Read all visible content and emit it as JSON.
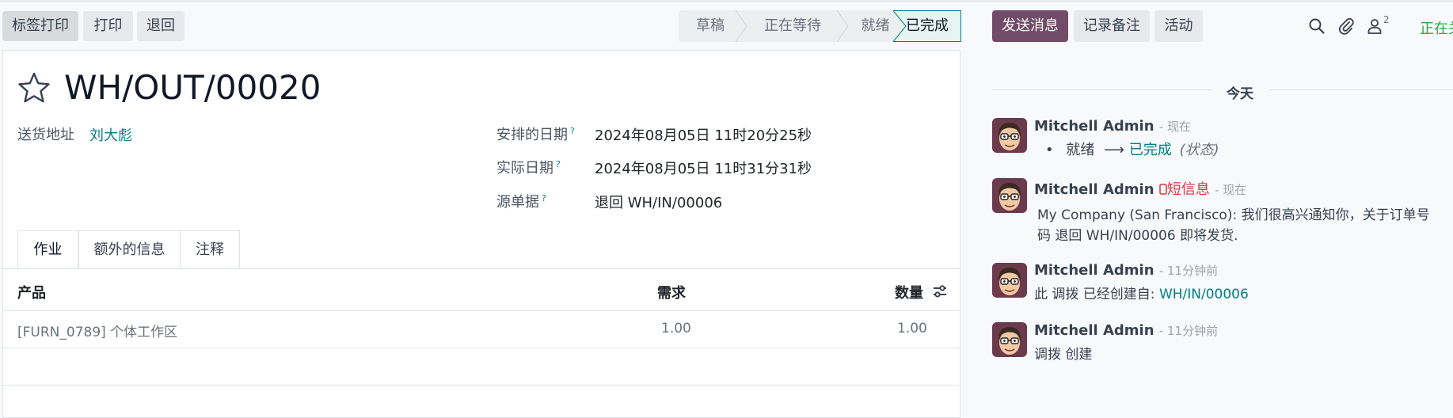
{
  "toolbar": {
    "label_print": "标签打印",
    "print": "打印",
    "return": "退回"
  },
  "statusbar": {
    "stages": [
      "草稿",
      "正在等待",
      "就绪",
      "已完成"
    ],
    "active_stage": "已完成"
  },
  "chatter_toolbar": {
    "send_message": "发送消息",
    "log_note": "记录备注",
    "activity": "活动",
    "followers_count": "2",
    "status_text": "正在关注"
  },
  "form": {
    "title": "WH/OUT/00020",
    "delivery_address_label": "送货地址",
    "delivery_address_value": "刘大彪",
    "scheduled_date_label": "安排的日期",
    "scheduled_date_value": "2024年08月05日 11时20分25秒",
    "effective_date_label": "实际日期",
    "effective_date_value": "2024年08月05日 11时31分31秒",
    "source_doc_label": "源单据",
    "source_doc_value": "退回 WH/IN/00006",
    "help_mark": "?"
  },
  "tabs": [
    "作业",
    "额外的信息",
    "注释"
  ],
  "table": {
    "headers": {
      "product": "产品",
      "demand": "需求",
      "quantity": "数量"
    },
    "rows": [
      {
        "product": "[FURN_0789] 个体工作区",
        "demand": "1.00",
        "quantity": "1.00"
      }
    ]
  },
  "chatter": {
    "today": "今天",
    "messages": [
      {
        "author": "Mitchell Admin",
        "time": "现在",
        "from_state": "就绪",
        "to_state": "已完成",
        "field": "(状态)"
      },
      {
        "author": "Mitchell Admin",
        "badge": "短信息",
        "time": "现在",
        "line1": "My Company (San Francisco): 我们很高兴通知你，关于订单号",
        "line2": "码 退回 WH/IN/00006 即将发货."
      },
      {
        "author": "Mitchell Admin",
        "time": "11分钟前",
        "text": "此 调拨 已经创建自:",
        "link": "WH/IN/00006"
      },
      {
        "author": "Mitchell Admin",
        "time": "11分钟前",
        "text": "调拨 创建"
      }
    ]
  },
  "colors": {
    "primary": "#714b67",
    "accent": "#017e84",
    "danger": "#dc3545",
    "success": "#28a745"
  },
  "icons": [
    "search-icon",
    "paperclip-icon",
    "followers-icon",
    "star-icon",
    "column-settings-icon",
    "sms-icon",
    "avatar"
  ]
}
